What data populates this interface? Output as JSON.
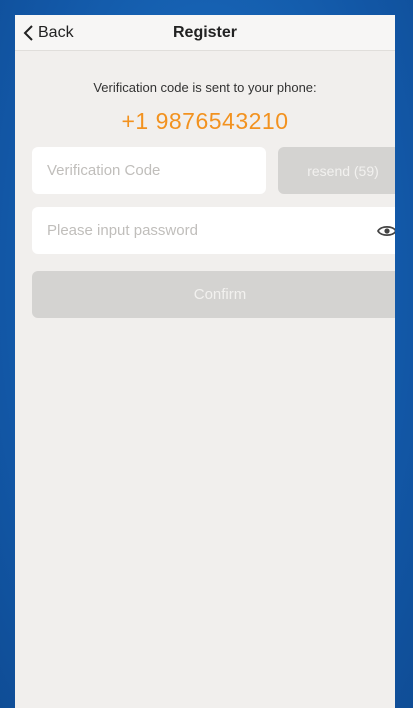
{
  "nav": {
    "back_label": "Back",
    "back_icon": "chevron-left-icon",
    "title": "Register"
  },
  "verification": {
    "info": "Verification code is sent to your phone:",
    "phone": "+1 9876543210",
    "phone_color": "#f2921f"
  },
  "form": {
    "code_placeholder": "Verification Code",
    "resend_label": "resend (59)",
    "password_placeholder": "Please input password",
    "visibility_icon": "eye-icon",
    "confirm_label": "Confirm"
  },
  "colors": {
    "background": "#1565b8",
    "screen": "#f1efed",
    "disabled_button": "#d4d3d1",
    "accent": "#f2921f"
  }
}
